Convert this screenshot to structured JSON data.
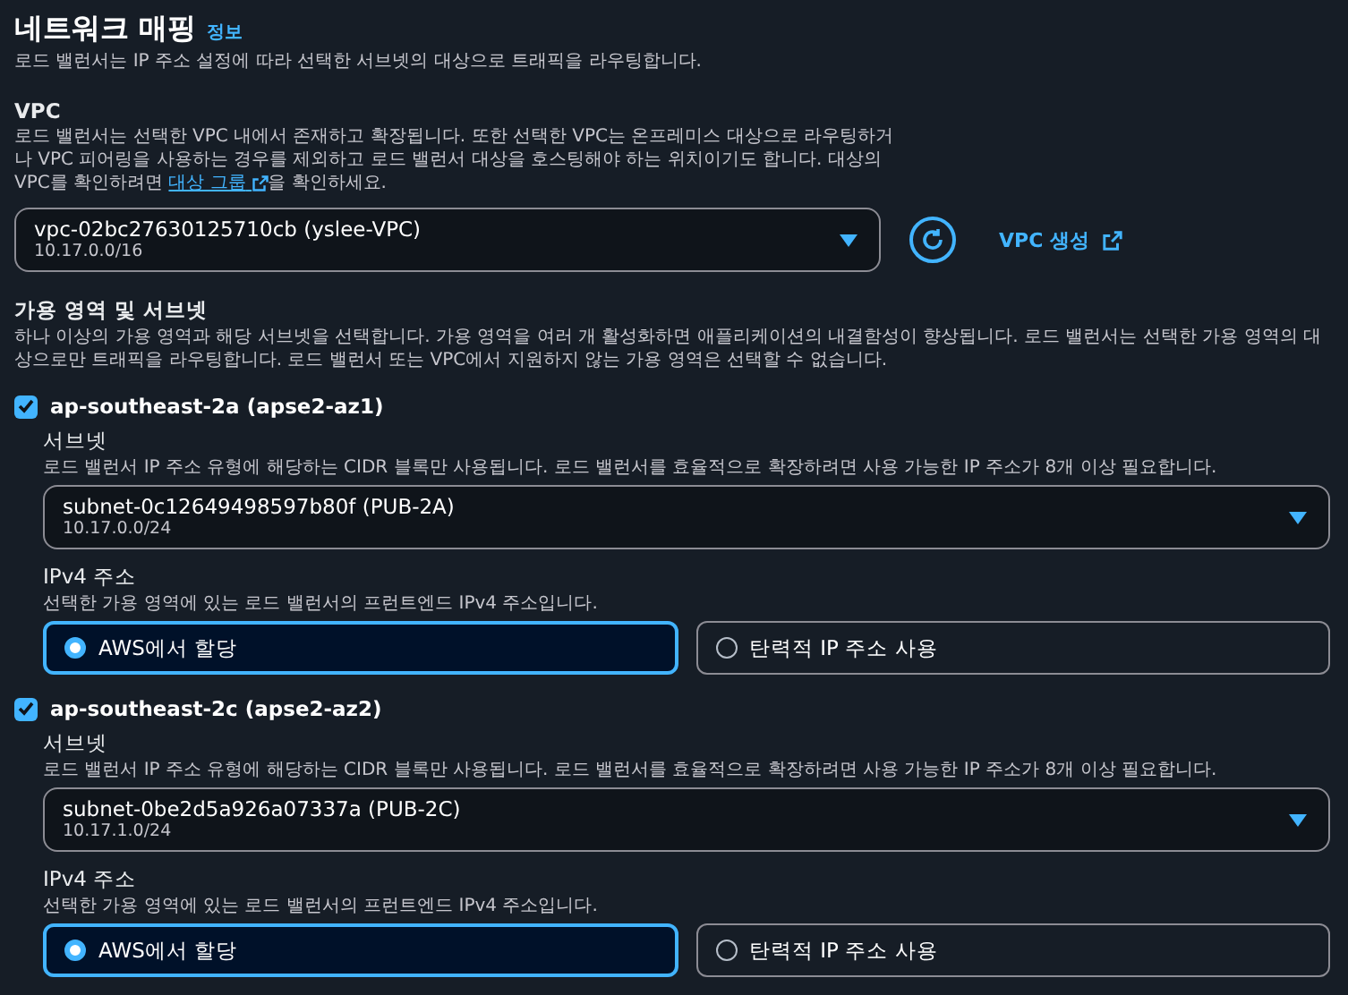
{
  "section": {
    "title": "네트워크 매핑",
    "info_link": "정보",
    "description": "로드 밸런서는 IP 주소 설정에 따라 선택한 서브넷의 대상으로 트래픽을 라우팅합니다."
  },
  "vpc": {
    "label": "VPC",
    "description_before": "로드 밸런서는 선택한 VPC 내에서 존재하고 확장됩니다. 또한 선택한 VPC는 온프레미스 대상으로 라우팅하거나 VPC 피어링을 사용하는 경우를 제외하고 로드 밸런서 대상을 호스팅해야 하는 위치이기도 합니다. 대상의 VPC를 확인하려면 ",
    "link": "대상 그룹",
    "description_after": "을 확인하세요.",
    "select": {
      "value": "vpc-02bc27630125710cb (yslee-VPC)",
      "sub": "10.17.0.0/16"
    },
    "create_button": "VPC 생성"
  },
  "zones": {
    "label": "가용 영역 및 서브넷",
    "description": "하나 이상의 가용 영역과 해당 서브넷을 선택합니다. 가용 영역을 여러 개 활성화하면 애플리케이션의 내결함성이 향상됩니다. 로드 밸런서는 선택한 가용 영역의 대상으로만 트래픽을 라우팅합니다. 로드 밸런서 또는 VPC에서 지원하지 않는 가용 영역은 선택할 수 없습니다.",
    "items": [
      {
        "name": "ap-southeast-2a (apse2-az1)",
        "checked": true,
        "subnet_label": "서브넷",
        "subnet_description": "로드 밸런서 IP 주소 유형에 해당하는 CIDR 블록만 사용됩니다. 로드 밸런서를 효율적으로 확장하려면 사용 가능한 IP 주소가 8개 이상 필요합니다.",
        "subnet": {
          "value": "subnet-0c12649498597b80f (PUB-2A)",
          "sub": "10.17.0.0/24"
        },
        "ipv4_label": "IPv4 주소",
        "ipv4_description": "선택한 가용 영역에 있는 로드 밸런서의 프런트엔드 IPv4 주소입니다.",
        "options": [
          {
            "label": "AWS에서 할당",
            "selected": true
          },
          {
            "label": "탄력적 IP 주소 사용",
            "selected": false
          }
        ]
      },
      {
        "name": "ap-southeast-2c (apse2-az2)",
        "checked": true,
        "subnet_label": "서브넷",
        "subnet_description": "로드 밸런서 IP 주소 유형에 해당하는 CIDR 블록만 사용됩니다. 로드 밸런서를 효율적으로 확장하려면 사용 가능한 IP 주소가 8개 이상 필요합니다.",
        "subnet": {
          "value": "subnet-0be2d5a926a07337a (PUB-2C)",
          "sub": "10.17.1.0/24"
        },
        "ipv4_label": "IPv4 주소",
        "ipv4_description": "선택한 가용 영역에 있는 로드 밸런서의 프런트엔드 IPv4 주소입니다.",
        "options": [
          {
            "label": "AWS에서 할당",
            "selected": true
          },
          {
            "label": "탄력적 IP 주소 사용",
            "selected": false
          }
        ]
      }
    ]
  }
}
